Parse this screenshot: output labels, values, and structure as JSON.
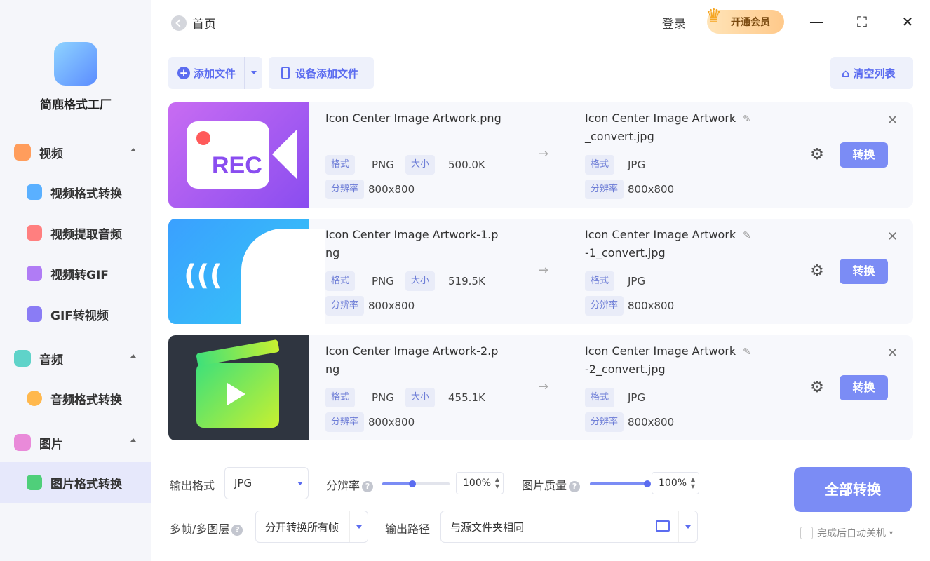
{
  "app": {
    "name": "简鹿格式工厂"
  },
  "header": {
    "home": "首页",
    "login": "登录",
    "vip": "开通会员"
  },
  "sidebar": {
    "video": {
      "label": "视频",
      "items": [
        "视频格式转换",
        "视频提取音频",
        "视频转GIF",
        "GIF转视频"
      ]
    },
    "audio": {
      "label": "音频",
      "items": [
        "音频格式转换"
      ]
    },
    "image": {
      "label": "图片",
      "items": [
        "图片格式转换"
      ]
    }
  },
  "toolbar": {
    "add_file": "添加文件",
    "device_add": "设备添加文件",
    "clear": "清空列表"
  },
  "labels": {
    "format": "格式",
    "size": "大小",
    "resolution": "分辨率",
    "convert": "转换"
  },
  "files": [
    {
      "name": "Icon Center Image Artwork.png",
      "format": "PNG",
      "size": "500.0K",
      "resolution": "800x800",
      "out_name": "Icon Center Image Artwork\n_convert.jpg",
      "out_format": "JPG",
      "out_resolution": "800x800",
      "thumb_text": "REC"
    },
    {
      "name": "Icon Center Image Artwork-1.png",
      "format": "PNG",
      "size": "519.5K",
      "resolution": "800x800",
      "out_name": "Icon Center Image Artwork\n-1_convert.jpg",
      "out_format": "JPG",
      "out_resolution": "800x800"
    },
    {
      "name": "Icon Center Image Artwork-2.png",
      "format": "PNG",
      "size": "455.1K",
      "resolution": "800x800",
      "out_name": "Icon Center Image Artwork\n-2_convert.jpg",
      "out_format": "JPG",
      "out_resolution": "800x800"
    }
  ],
  "bottom": {
    "output_format_label": "输出格式",
    "output_format": "JPG",
    "resolution_label": "分辨率",
    "resolution_value": "100%",
    "resolution_fraction": 0.45,
    "quality_label": "图片质量",
    "quality_value": "100%",
    "quality_fraction": 1.0,
    "multi_frame_label": "多帧/多图层",
    "multi_frame": "分开转换所有帧",
    "output_path_label": "输出路径",
    "output_path": "与源文件夹相同",
    "convert_all": "全部转换",
    "auto_shutdown": "完成后自动关机"
  },
  "colors": {
    "accent": "#7b8cf5",
    "sidebar_bg": "#f5f6fa",
    "active_bg": "#e6e8fb"
  }
}
